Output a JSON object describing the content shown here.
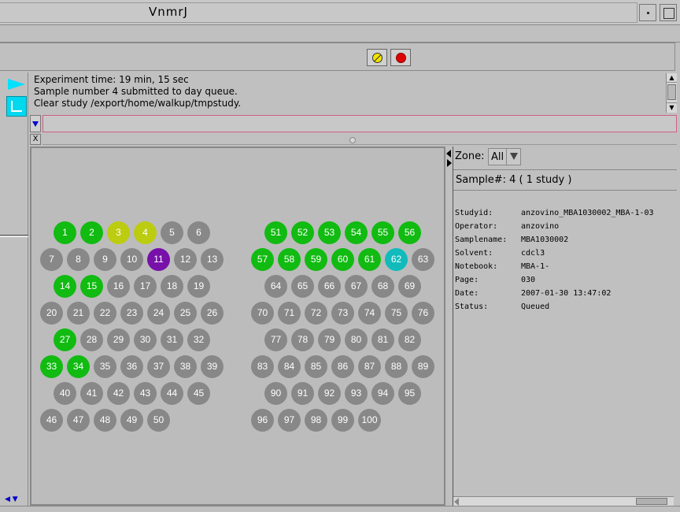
{
  "window": {
    "title": "VnmrJ"
  },
  "messages": [
    "Experiment time: 19 min, 15 sec",
    "Sample number 4 submitted to day queue.",
    "Clear study /export/home/walkup/tmpstudy."
  ],
  "command_line": {
    "value": "",
    "close_label": "X"
  },
  "icons": {
    "play": "play-icon",
    "spectrum": "spectrum-icon",
    "pause": "pause-icon",
    "record": "record-icon"
  },
  "colors": {
    "complete": "#11bb11",
    "queued": "#bbcc11",
    "active": "#7711aa",
    "selected": "#11bbbb",
    "empty": "#888888"
  },
  "tray": {
    "samples": [
      {
        "n": 1,
        "s": "complete"
      },
      {
        "n": 2,
        "s": "complete"
      },
      {
        "n": 3,
        "s": "queued"
      },
      {
        "n": 4,
        "s": "queued"
      },
      {
        "n": 5,
        "s": "empty"
      },
      {
        "n": 6,
        "s": "empty"
      },
      {
        "n": 7,
        "s": "empty"
      },
      {
        "n": 8,
        "s": "empty"
      },
      {
        "n": 9,
        "s": "empty"
      },
      {
        "n": 10,
        "s": "empty"
      },
      {
        "n": 11,
        "s": "active"
      },
      {
        "n": 12,
        "s": "empty"
      },
      {
        "n": 13,
        "s": "empty"
      },
      {
        "n": 14,
        "s": "complete"
      },
      {
        "n": 15,
        "s": "complete"
      },
      {
        "n": 16,
        "s": "empty"
      },
      {
        "n": 17,
        "s": "empty"
      },
      {
        "n": 18,
        "s": "empty"
      },
      {
        "n": 19,
        "s": "empty"
      },
      {
        "n": 20,
        "s": "empty"
      },
      {
        "n": 21,
        "s": "empty"
      },
      {
        "n": 22,
        "s": "empty"
      },
      {
        "n": 23,
        "s": "empty"
      },
      {
        "n": 24,
        "s": "empty"
      },
      {
        "n": 25,
        "s": "empty"
      },
      {
        "n": 26,
        "s": "empty"
      },
      {
        "n": 27,
        "s": "complete"
      },
      {
        "n": 28,
        "s": "empty"
      },
      {
        "n": 29,
        "s": "empty"
      },
      {
        "n": 30,
        "s": "empty"
      },
      {
        "n": 31,
        "s": "empty"
      },
      {
        "n": 32,
        "s": "empty"
      },
      {
        "n": 33,
        "s": "complete"
      },
      {
        "n": 34,
        "s": "complete"
      },
      {
        "n": 35,
        "s": "empty"
      },
      {
        "n": 36,
        "s": "empty"
      },
      {
        "n": 37,
        "s": "empty"
      },
      {
        "n": 38,
        "s": "empty"
      },
      {
        "n": 39,
        "s": "empty"
      },
      {
        "n": 40,
        "s": "empty"
      },
      {
        "n": 41,
        "s": "empty"
      },
      {
        "n": 42,
        "s": "empty"
      },
      {
        "n": 43,
        "s": "empty"
      },
      {
        "n": 44,
        "s": "empty"
      },
      {
        "n": 45,
        "s": "empty"
      },
      {
        "n": 46,
        "s": "empty"
      },
      {
        "n": 47,
        "s": "empty"
      },
      {
        "n": 48,
        "s": "empty"
      },
      {
        "n": 49,
        "s": "empty"
      },
      {
        "n": 50,
        "s": "empty"
      },
      {
        "n": 51,
        "s": "complete"
      },
      {
        "n": 52,
        "s": "complete"
      },
      {
        "n": 53,
        "s": "complete"
      },
      {
        "n": 54,
        "s": "complete"
      },
      {
        "n": 55,
        "s": "complete"
      },
      {
        "n": 56,
        "s": "complete"
      },
      {
        "n": 57,
        "s": "complete"
      },
      {
        "n": 58,
        "s": "complete"
      },
      {
        "n": 59,
        "s": "complete"
      },
      {
        "n": 60,
        "s": "complete"
      },
      {
        "n": 61,
        "s": "complete"
      },
      {
        "n": 62,
        "s": "selected"
      },
      {
        "n": 63,
        "s": "empty"
      },
      {
        "n": 64,
        "s": "empty"
      },
      {
        "n": 65,
        "s": "empty"
      },
      {
        "n": 66,
        "s": "empty"
      },
      {
        "n": 67,
        "s": "empty"
      },
      {
        "n": 68,
        "s": "empty"
      },
      {
        "n": 69,
        "s": "empty"
      },
      {
        "n": 70,
        "s": "empty"
      },
      {
        "n": 71,
        "s": "empty"
      },
      {
        "n": 72,
        "s": "empty"
      },
      {
        "n": 73,
        "s": "empty"
      },
      {
        "n": 74,
        "s": "empty"
      },
      {
        "n": 75,
        "s": "empty"
      },
      {
        "n": 76,
        "s": "empty"
      },
      {
        "n": 77,
        "s": "empty"
      },
      {
        "n": 78,
        "s": "empty"
      },
      {
        "n": 79,
        "s": "empty"
      },
      {
        "n": 80,
        "s": "empty"
      },
      {
        "n": 81,
        "s": "empty"
      },
      {
        "n": 82,
        "s": "empty"
      },
      {
        "n": 83,
        "s": "empty"
      },
      {
        "n": 84,
        "s": "empty"
      },
      {
        "n": 85,
        "s": "empty"
      },
      {
        "n": 86,
        "s": "empty"
      },
      {
        "n": 87,
        "s": "empty"
      },
      {
        "n": 88,
        "s": "empty"
      },
      {
        "n": 89,
        "s": "empty"
      },
      {
        "n": 90,
        "s": "empty"
      },
      {
        "n": 91,
        "s": "empty"
      },
      {
        "n": 92,
        "s": "empty"
      },
      {
        "n": 93,
        "s": "empty"
      },
      {
        "n": 94,
        "s": "empty"
      },
      {
        "n": 95,
        "s": "empty"
      },
      {
        "n": 96,
        "s": "empty"
      },
      {
        "n": 97,
        "s": "empty"
      },
      {
        "n": 98,
        "s": "empty"
      },
      {
        "n": 99,
        "s": "empty"
      },
      {
        "n": 100,
        "s": "empty"
      }
    ]
  },
  "info": {
    "zone_label": "Zone:",
    "zone_value": "All",
    "sample_header": "Sample#: 4   ( 1 study )",
    "details": [
      {
        "label": "Studyid:",
        "value": "anzovino_MBA1030002_MBA-1-03"
      },
      {
        "label": "Operator:",
        "value": "anzovino"
      },
      {
        "label": "Samplename:",
        "value": "MBA1030002"
      },
      {
        "label": "Solvent:",
        "value": "cdcl3"
      },
      {
        "label": "Notebook:",
        "value": "MBA-1-"
      },
      {
        "label": "Page:",
        "value": "030"
      },
      {
        "label": "Date:",
        "value": "2007-01-30 13:47:02"
      },
      {
        "label": "Status:",
        "value": "Queued"
      }
    ]
  }
}
